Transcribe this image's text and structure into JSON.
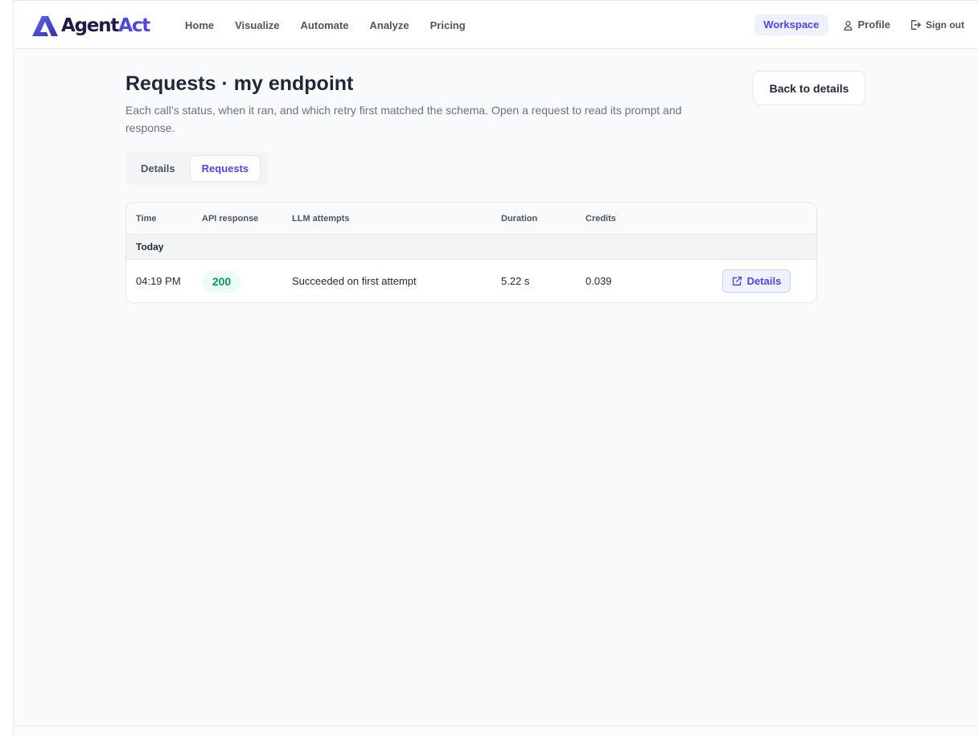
{
  "brand": {
    "name_part1": "Agent",
    "name_part2": "Act"
  },
  "nav": {
    "items": [
      {
        "label": "Home"
      },
      {
        "label": "Visualize"
      },
      {
        "label": "Automate"
      },
      {
        "label": "Analyze"
      },
      {
        "label": "Pricing"
      }
    ],
    "workspace_label": "Workspace",
    "profile_label": "Profile",
    "signout_label": "Sign out"
  },
  "page": {
    "title": "Requests · my endpoint",
    "description": "Each call’s status, when it ran, and which retry first matched the schema. Open a request to read its prompt and response.",
    "back_label": "Back to details"
  },
  "tabs": [
    {
      "label": "Details",
      "active": false
    },
    {
      "label": "Requests",
      "active": true
    }
  ],
  "table": {
    "headers": [
      "Time",
      "API response",
      "LLM attempts",
      "Duration",
      "Credits"
    ],
    "groups": [
      {
        "label": "Today",
        "rows": [
          {
            "time": "04:19 PM",
            "status": "200",
            "attempts": "Succeeded on first attempt",
            "duration": "5.22 s",
            "credits": "0.039",
            "action_label": "Details"
          }
        ]
      }
    ]
  },
  "colors": {
    "accent": "#4f46e5",
    "success": "#059669",
    "success_bg": "#ecfdf5"
  }
}
